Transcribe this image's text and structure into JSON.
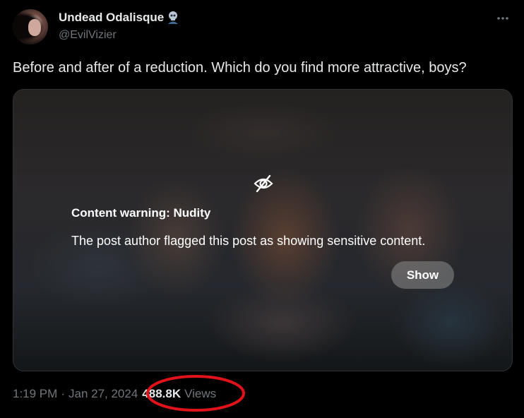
{
  "author": {
    "display_name": "Undead Odalisque",
    "handle": "@EvilVizier",
    "badge_icon": "skull-emoji-icon"
  },
  "header": {
    "more_icon": "more-horizontal-icon"
  },
  "tweet": {
    "text": "Before and after of a reduction. Which do you find more attractive, boys?"
  },
  "media": {
    "icon": "eye-slash-icon",
    "warning_title": "Content warning: Nudity",
    "warning_description": "The post author flagged this post as showing sensitive content.",
    "show_label": "Show"
  },
  "meta": {
    "time": "1:19 PM",
    "separator": "·",
    "date": "Jan 27, 2024",
    "views_count": "488.8K",
    "views_label": "Views"
  },
  "colors": {
    "background": "#000000",
    "primary_text": "#e7e9ea",
    "secondary_text": "#71767b",
    "annotation_red": "#e0131b"
  }
}
